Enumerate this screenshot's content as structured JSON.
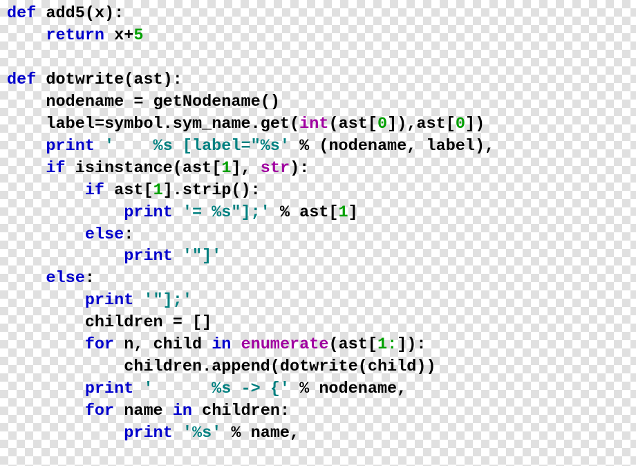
{
  "tok": {
    "def": "def",
    "return": "return",
    "print": "print",
    "if": "if",
    "else": "else",
    "for": "for",
    "in": "in",
    "int": "int",
    "str_t": "str",
    "isinstance": "isinstance",
    "enumerate": "enumerate",
    "add5": "add5",
    "x": "x",
    "plus": "+",
    "five": "5",
    "dotwrite": "dotwrite",
    "ast": "ast",
    "nodename": "nodename",
    "getNodename": "getNodename",
    "label": "label",
    "symbol": "symbol",
    "sym_name": "sym_name",
    "get": "get",
    "zero": "0",
    "one": "1",
    "strip": "strip",
    "children": "children",
    "append": "append",
    "n": "n",
    "child": "child",
    "name": "name",
    "str_label_fmt": "'    %s [label=\"%s'",
    "str_eq_fmt": "'= %s\"];'",
    "str_close1": "'\"]'",
    "str_close2": "'\"];'",
    "str_arrow": "'      %s -> {'",
    "str_name": "'%s'",
    "lparen": "(",
    "rparen": ")",
    "lbrack": "[",
    "rbrack": "]",
    "colon": ":",
    "comma": ",",
    "dot": ".",
    "eq": "=",
    "pct": "%",
    "empty_list": "[]",
    "slice1": "1:"
  }
}
